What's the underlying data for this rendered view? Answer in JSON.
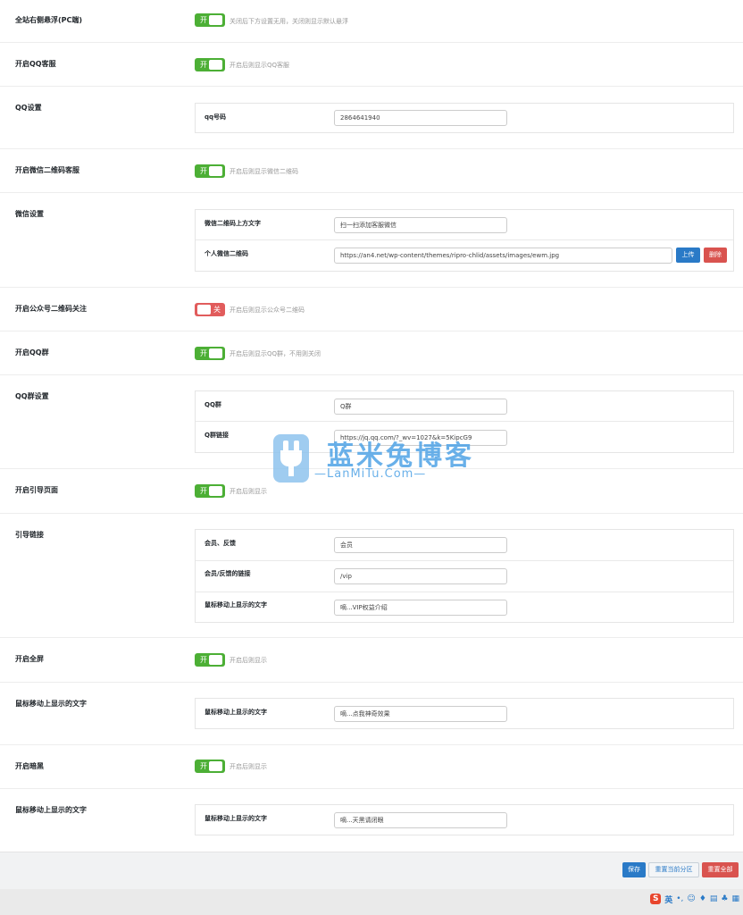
{
  "colors": {
    "toggle_on": "#4caf35",
    "toggle_off": "#e15c5c",
    "primary_button": "#2a7ac7",
    "danger_button": "#d9534f"
  },
  "settings": [
    {
      "label": "全站右侧悬浮(PC端)",
      "toggle": "开",
      "toggle_on": true,
      "desc": "关闭后下方设置无用，关闭则显示默认悬浮"
    },
    {
      "label": "开启QQ客服",
      "toggle": "开",
      "toggle_on": true,
      "desc": "开启后则显示QQ客服"
    },
    {
      "label": "QQ设置",
      "fields": [
        {
          "label": "qq号码",
          "value": "2864641940"
        }
      ]
    },
    {
      "label": "开启微信二维码客服",
      "toggle": "开",
      "toggle_on": true,
      "desc": "开启后则显示微信二维码"
    },
    {
      "label": "微信设置",
      "fields": [
        {
          "label": "微信二维码上方文字",
          "value": "扫一扫添加客服微信"
        },
        {
          "label": "个人微信二维码",
          "value": "https://an4.net/wp-content/themes/ripro-chlid/assets/images/ewm.jpg",
          "upload_label": "上传",
          "delete_label": "删除"
        }
      ]
    },
    {
      "label": "开启公众号二维码关注",
      "toggle": "关",
      "toggle_on": false,
      "desc": "开启后则显示公众号二维码"
    },
    {
      "label": "开启QQ群",
      "toggle": "开",
      "toggle_on": true,
      "desc": "开启后则显示QQ群，不用则关闭"
    },
    {
      "label": "QQ群设置",
      "fields": [
        {
          "label": "QQ群",
          "value": "Q群"
        },
        {
          "label": "Q群链接",
          "value": "https://jq.qq.com/?_wv=1027&k=5KipcG9"
        }
      ]
    },
    {
      "label": "开启引导页面",
      "toggle": "开",
      "toggle_on": true,
      "desc": "开启后则显示"
    },
    {
      "label": "引导链接",
      "fields": [
        {
          "label": "会员、反馈",
          "value": "会员"
        },
        {
          "label": "会员/反馈的链接",
          "value": "/vip"
        },
        {
          "label": "鼠标移动上显示的文字",
          "value": "嘀...VIP权益介绍"
        }
      ]
    },
    {
      "label": "开启全屏",
      "toggle": "开",
      "toggle_on": true,
      "desc": "开启后则显示"
    },
    {
      "label": "鼠标移动上显示的文字",
      "fields": [
        {
          "label": "鼠标移动上显示的文字",
          "value": "嘀...点我神奇效果"
        }
      ]
    },
    {
      "label": "开启暗黑",
      "toggle": "开",
      "toggle_on": true,
      "desc": "开启后则显示"
    },
    {
      "label": "鼠标移动上显示的文字",
      "fields": [
        {
          "label": "鼠标移动上显示的文字",
          "value": "嘀...天黑请闭眼"
        }
      ]
    }
  ],
  "footer": {
    "save_label": "保存",
    "reset_section_label": "重置当前分区",
    "reset_all_label": "重置全部"
  },
  "watermark": {
    "title": "蓝米兔博客",
    "subtitle": "—LanMiTu.Com—"
  },
  "ime_bar": {
    "logo": "S",
    "lang": "英",
    "icons": [
      "punctuation-icon",
      "emoji-icon",
      "microphone-icon",
      "keyboard-icon",
      "clothes-icon",
      "grid-icon"
    ]
  }
}
